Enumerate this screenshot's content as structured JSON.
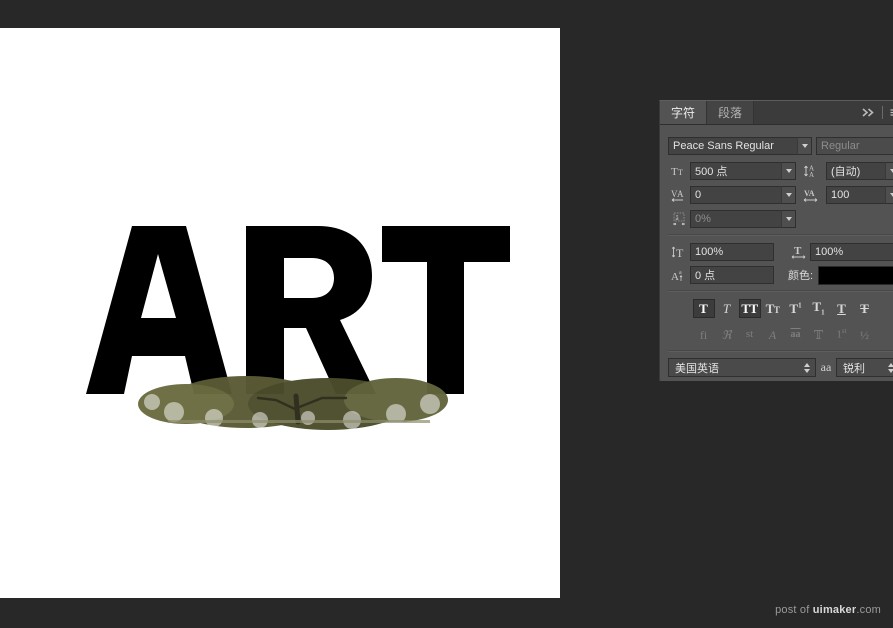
{
  "app": {
    "workspace_bg": "#282828",
    "canvas_bg": "#ffffff"
  },
  "canvas": {
    "artwork_text": "ART",
    "artwork_description": "tree-foliage-masked-into-ART-letters",
    "text_color": "#000000",
    "foliage_colors": [
      "#6f7042",
      "#4a4a28",
      "#262612",
      "#8d8a5c"
    ]
  },
  "character_panel": {
    "tabs": [
      {
        "label": "字符",
        "active": true
      },
      {
        "label": "段落",
        "active": false
      }
    ],
    "collapse_icon": "double-chevron-right-icon",
    "menu_icon": "panel-menu-icon",
    "font_family": {
      "icon": "font-family-icon",
      "value": "Peace Sans Regular"
    },
    "font_style": {
      "icon": "font-style-icon",
      "value": "Regular",
      "enabled": false
    },
    "font_size": {
      "icon": "font-size-icon",
      "value": "500 点"
    },
    "leading": {
      "icon": "leading-icon",
      "value": "(自动)"
    },
    "kerning": {
      "icon": "kerning-icon",
      "value": "0"
    },
    "tracking": {
      "icon": "tracking-icon",
      "value": "100"
    },
    "vertical_align_shift": {
      "icon": "text-proportional-icon",
      "value": "0%",
      "enabled": false
    },
    "vertical_scale": {
      "icon": "vertical-scale-icon",
      "value": "100%"
    },
    "horizontal_scale": {
      "icon": "horizontal-scale-icon",
      "value": "100%"
    },
    "baseline_shift": {
      "icon": "baseline-shift-icon",
      "value": "0 点"
    },
    "color": {
      "label": "颜色:",
      "value": "#000000"
    },
    "faux_styles": [
      {
        "name": "faux-bold",
        "glyph": "T",
        "active": false,
        "enabled": true
      },
      {
        "name": "faux-italic",
        "glyph": "T",
        "active": false,
        "enabled": true
      },
      {
        "name": "all-caps",
        "glyph": "TT",
        "active": true,
        "enabled": true
      },
      {
        "name": "small-caps",
        "glyph": "TT",
        "active": false,
        "enabled": true
      },
      {
        "name": "superscript",
        "glyph": "T¹",
        "active": false,
        "enabled": true
      },
      {
        "name": "subscript",
        "glyph": "T₁",
        "active": false,
        "enabled": true
      },
      {
        "name": "underline",
        "glyph": "T",
        "active": false,
        "enabled": true
      },
      {
        "name": "strikethrough",
        "glyph": "T",
        "active": false,
        "enabled": true
      }
    ],
    "opentype_styles": [
      {
        "name": "standard-ligatures",
        "glyph": "fi",
        "enabled": false
      },
      {
        "name": "contextual-alternates",
        "glyph": "ℴ",
        "enabled": false
      },
      {
        "name": "discretionary-ligatures",
        "glyph": "st",
        "enabled": false
      },
      {
        "name": "swash",
        "glyph": "𝒜",
        "enabled": false
      },
      {
        "name": "stylistic-alternates",
        "glyph": "aa",
        "enabled": false
      },
      {
        "name": "titling-alternates",
        "glyph": "T",
        "enabled": false
      },
      {
        "name": "ordinals",
        "glyph": "1st",
        "enabled": false
      },
      {
        "name": "fractions",
        "glyph": "½",
        "enabled": false
      }
    ],
    "language": {
      "value": "美国英语"
    },
    "antialias": {
      "icon": "anti-alias-icon",
      "icon_glyph": "aa",
      "value": "锐利"
    }
  },
  "watermark": {
    "prefix": "post of ",
    "brand": "uimaker",
    "suffix": ".com"
  }
}
